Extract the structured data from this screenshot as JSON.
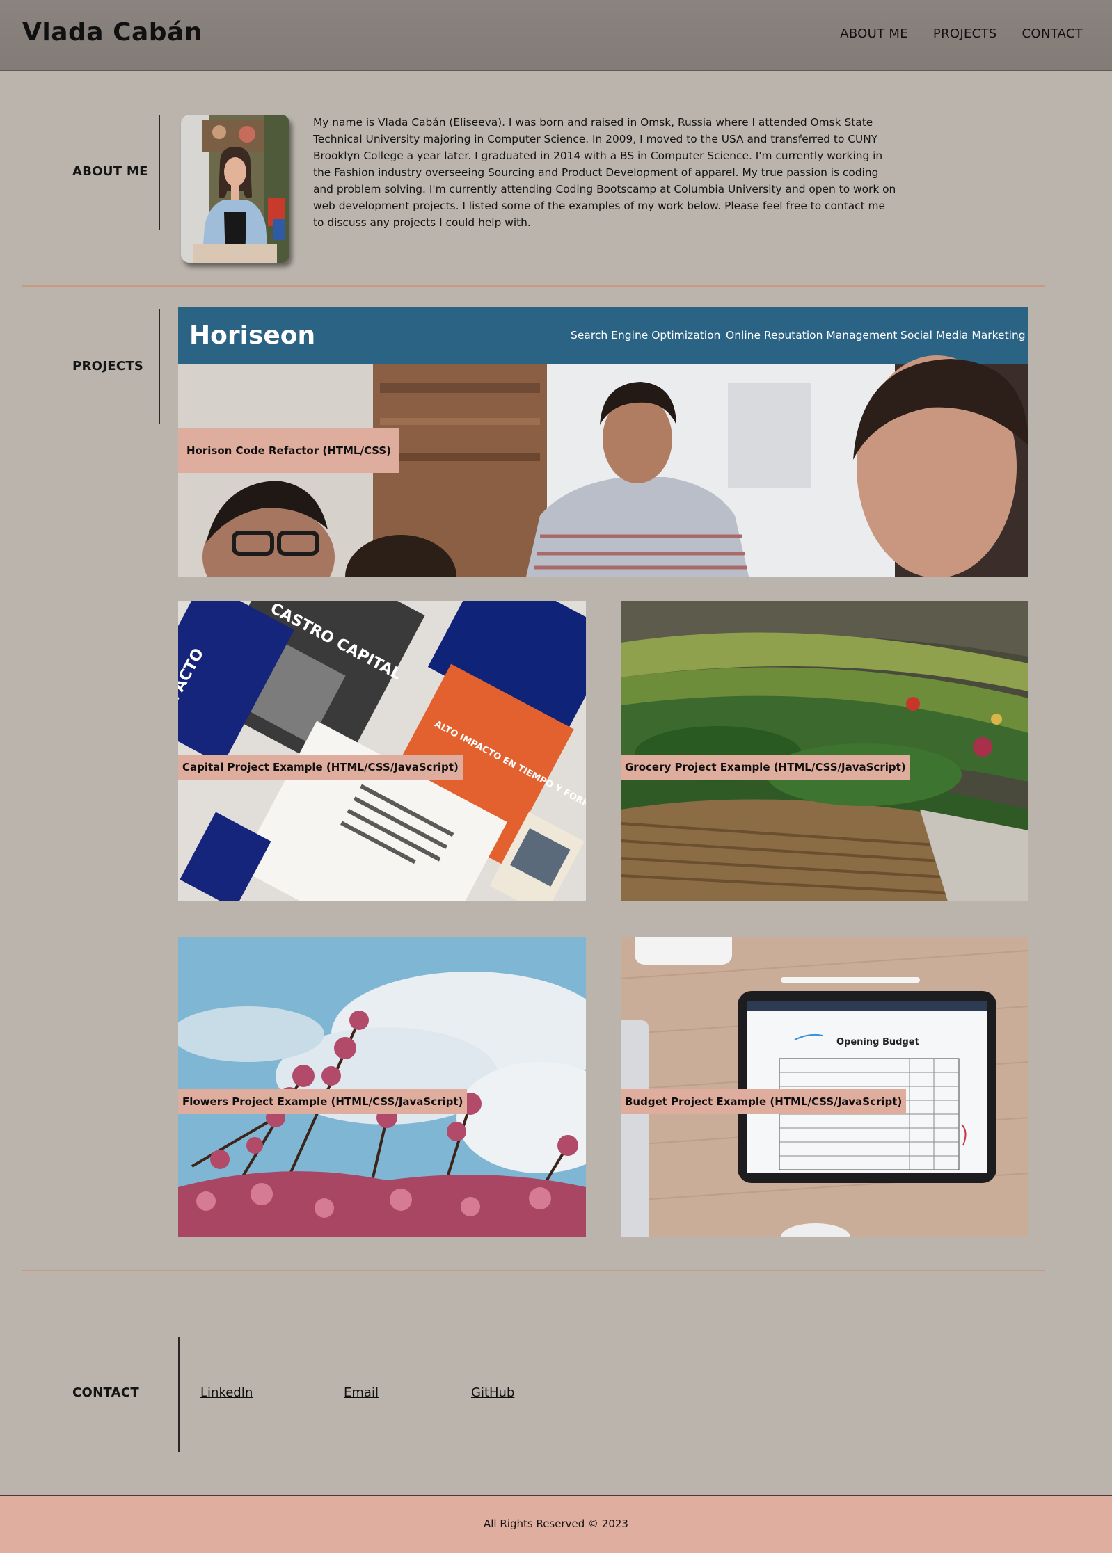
{
  "header": {
    "title": "Vlada Cabán",
    "nav": [
      "ABOUT ME",
      "PROJECTS",
      "CONTACT"
    ]
  },
  "about": {
    "label": "ABOUT ME",
    "bio": "My name is Vlada Cabán (Eliseeva). I was born and raised in Omsk, Russia where I attended Omsk State Technical University majoring in Computer Science. In 2009, I moved to the USA and transferred to CUNY Brooklyn College a year later. I graduated in 2014 with a BS in Computer Science. I'm currently working in the Fashion industry overseeing Sourcing and Product Development of apparel. My true passion is coding and problem solving. I'm currently attending Coding Bootscamp at Columbia University and open to work on web development projects. I listed some of the examples of my work below. Please feel free to contact me to discuss any projects I could help with."
  },
  "projects": {
    "label": "PROJECTS",
    "featured": {
      "label": "Horison Code Refactor (HTML/CSS)",
      "brand": "Horiseon",
      "nav": [
        "Search Engine Optimization",
        "Online Reputation Management",
        "Social Media Marketing"
      ]
    },
    "items": [
      {
        "label": "Capital Project Example (HTML/CSS/JavaScript)",
        "art": [
          "CASTRO CAPITAL",
          "ALTO IMPACTO EN TIEMPO Y FORMA",
          "IMPACTO"
        ]
      },
      {
        "label": "Grocery Project Example (HTML/CSS/JavaScript)"
      },
      {
        "label": "Flowers Project Example (HTML/CSS/JavaScript)"
      },
      {
        "label": "Budget Project Example (HTML/CSS/JavaScript)",
        "art": [
          "Opening Budget"
        ]
      }
    ]
  },
  "contact": {
    "label": "CONTACT",
    "links": [
      "LinkedIn",
      "Email",
      "GitHub"
    ]
  },
  "footer": {
    "text": "All Rights Reserved © 2023"
  }
}
